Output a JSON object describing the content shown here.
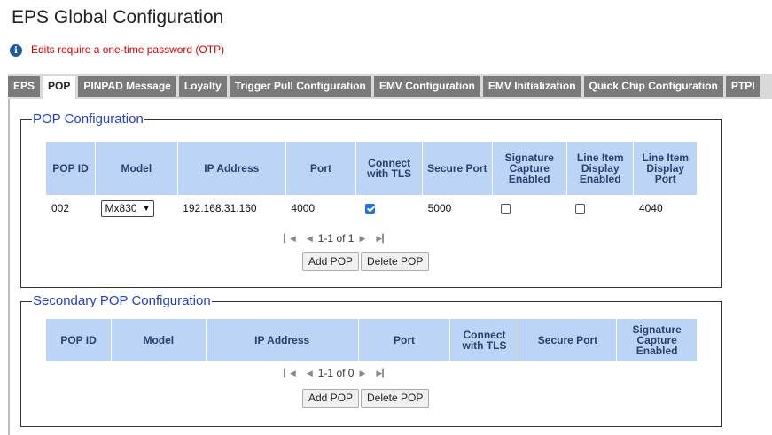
{
  "page_title": "EPS Global Configuration",
  "notice": "Edits require a one-time password (OTP)",
  "tabs": [
    "EPS",
    "POP",
    "PINPAD Message",
    "Loyalty",
    "Trigger Pull Configuration",
    "EMV Configuration",
    "EMV Initialization",
    "Quick Chip Configuration",
    "PTPI"
  ],
  "active_tab": "POP",
  "pop_config": {
    "legend": "POP Configuration",
    "columns": [
      "POP ID",
      "Model",
      "IP Address",
      "Port",
      "Connect with TLS",
      "Secure Port",
      "Signature Capture Enabled",
      "Line Item Display Enabled",
      "Line Item Display Port"
    ],
    "row": {
      "pop_id": "002",
      "model": "Mx830",
      "ip_address": "192.168.31.160",
      "port": "4000",
      "connect_tls": true,
      "secure_port": "5000",
      "signature_capture": false,
      "line_item_display": false,
      "line_item_display_port": "4040"
    },
    "pager": "1-1 of 1",
    "add_label": "Add POP",
    "delete_label": "Delete POP"
  },
  "secondary_pop_config": {
    "legend": "Secondary POP Configuration",
    "columns": [
      "POP ID",
      "Model",
      "IP Address",
      "Port",
      "Connect with TLS",
      "Secure Port",
      "Signature Capture Enabled"
    ],
    "pager": "1-1 of 0",
    "add_label": "Add POP",
    "delete_label": "Delete POP"
  },
  "colors": {
    "header_bg": "#bcd5f6",
    "legend": "#1f3fd6",
    "notice": "#d40000",
    "tab_bg": "#7a7a7a"
  }
}
